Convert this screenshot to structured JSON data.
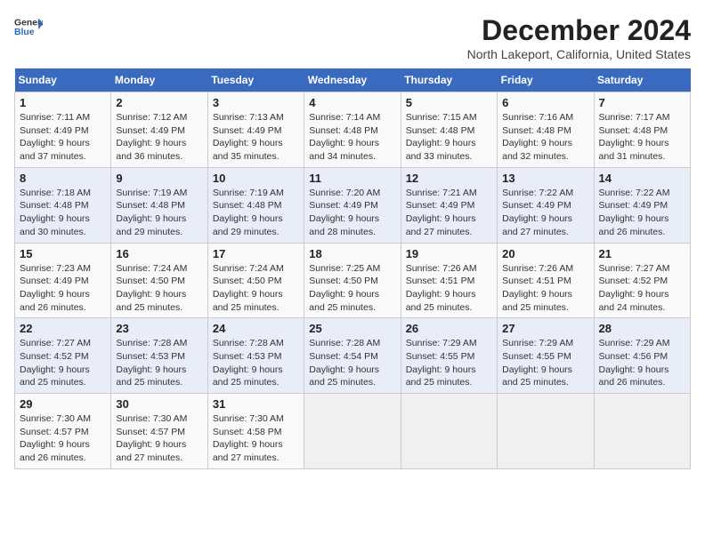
{
  "header": {
    "logo_line1": "General",
    "logo_line2": "Blue",
    "title": "December 2024",
    "subtitle": "North Lakeport, California, United States"
  },
  "days_of_week": [
    "Sunday",
    "Monday",
    "Tuesday",
    "Wednesday",
    "Thursday",
    "Friday",
    "Saturday"
  ],
  "weeks": [
    [
      {
        "day": "1",
        "info": "Sunrise: 7:11 AM\nSunset: 4:49 PM\nDaylight: 9 hours and 37 minutes."
      },
      {
        "day": "2",
        "info": "Sunrise: 7:12 AM\nSunset: 4:49 PM\nDaylight: 9 hours and 36 minutes."
      },
      {
        "day": "3",
        "info": "Sunrise: 7:13 AM\nSunset: 4:49 PM\nDaylight: 9 hours and 35 minutes."
      },
      {
        "day": "4",
        "info": "Sunrise: 7:14 AM\nSunset: 4:48 PM\nDaylight: 9 hours and 34 minutes."
      },
      {
        "day": "5",
        "info": "Sunrise: 7:15 AM\nSunset: 4:48 PM\nDaylight: 9 hours and 33 minutes."
      },
      {
        "day": "6",
        "info": "Sunrise: 7:16 AM\nSunset: 4:48 PM\nDaylight: 9 hours and 32 minutes."
      },
      {
        "day": "7",
        "info": "Sunrise: 7:17 AM\nSunset: 4:48 PM\nDaylight: 9 hours and 31 minutes."
      }
    ],
    [
      {
        "day": "8",
        "info": "Sunrise: 7:18 AM\nSunset: 4:48 PM\nDaylight: 9 hours and 30 minutes."
      },
      {
        "day": "9",
        "info": "Sunrise: 7:19 AM\nSunset: 4:48 PM\nDaylight: 9 hours and 29 minutes."
      },
      {
        "day": "10",
        "info": "Sunrise: 7:19 AM\nSunset: 4:48 PM\nDaylight: 9 hours and 29 minutes."
      },
      {
        "day": "11",
        "info": "Sunrise: 7:20 AM\nSunset: 4:49 PM\nDaylight: 9 hours and 28 minutes."
      },
      {
        "day": "12",
        "info": "Sunrise: 7:21 AM\nSunset: 4:49 PM\nDaylight: 9 hours and 27 minutes."
      },
      {
        "day": "13",
        "info": "Sunrise: 7:22 AM\nSunset: 4:49 PM\nDaylight: 9 hours and 27 minutes."
      },
      {
        "day": "14",
        "info": "Sunrise: 7:22 AM\nSunset: 4:49 PM\nDaylight: 9 hours and 26 minutes."
      }
    ],
    [
      {
        "day": "15",
        "info": "Sunrise: 7:23 AM\nSunset: 4:49 PM\nDaylight: 9 hours and 26 minutes."
      },
      {
        "day": "16",
        "info": "Sunrise: 7:24 AM\nSunset: 4:50 PM\nDaylight: 9 hours and 25 minutes."
      },
      {
        "day": "17",
        "info": "Sunrise: 7:24 AM\nSunset: 4:50 PM\nDaylight: 9 hours and 25 minutes."
      },
      {
        "day": "18",
        "info": "Sunrise: 7:25 AM\nSunset: 4:50 PM\nDaylight: 9 hours and 25 minutes."
      },
      {
        "day": "19",
        "info": "Sunrise: 7:26 AM\nSunset: 4:51 PM\nDaylight: 9 hours and 25 minutes."
      },
      {
        "day": "20",
        "info": "Sunrise: 7:26 AM\nSunset: 4:51 PM\nDaylight: 9 hours and 25 minutes."
      },
      {
        "day": "21",
        "info": "Sunrise: 7:27 AM\nSunset: 4:52 PM\nDaylight: 9 hours and 24 minutes."
      }
    ],
    [
      {
        "day": "22",
        "info": "Sunrise: 7:27 AM\nSunset: 4:52 PM\nDaylight: 9 hours and 25 minutes."
      },
      {
        "day": "23",
        "info": "Sunrise: 7:28 AM\nSunset: 4:53 PM\nDaylight: 9 hours and 25 minutes."
      },
      {
        "day": "24",
        "info": "Sunrise: 7:28 AM\nSunset: 4:53 PM\nDaylight: 9 hours and 25 minutes."
      },
      {
        "day": "25",
        "info": "Sunrise: 7:28 AM\nSunset: 4:54 PM\nDaylight: 9 hours and 25 minutes."
      },
      {
        "day": "26",
        "info": "Sunrise: 7:29 AM\nSunset: 4:55 PM\nDaylight: 9 hours and 25 minutes."
      },
      {
        "day": "27",
        "info": "Sunrise: 7:29 AM\nSunset: 4:55 PM\nDaylight: 9 hours and 25 minutes."
      },
      {
        "day": "28",
        "info": "Sunrise: 7:29 AM\nSunset: 4:56 PM\nDaylight: 9 hours and 26 minutes."
      }
    ],
    [
      {
        "day": "29",
        "info": "Sunrise: 7:30 AM\nSunset: 4:57 PM\nDaylight: 9 hours and 26 minutes."
      },
      {
        "day": "30",
        "info": "Sunrise: 7:30 AM\nSunset: 4:57 PM\nDaylight: 9 hours and 27 minutes."
      },
      {
        "day": "31",
        "info": "Sunrise: 7:30 AM\nSunset: 4:58 PM\nDaylight: 9 hours and 27 minutes."
      },
      {
        "day": "",
        "info": ""
      },
      {
        "day": "",
        "info": ""
      },
      {
        "day": "",
        "info": ""
      },
      {
        "day": "",
        "info": ""
      }
    ]
  ]
}
